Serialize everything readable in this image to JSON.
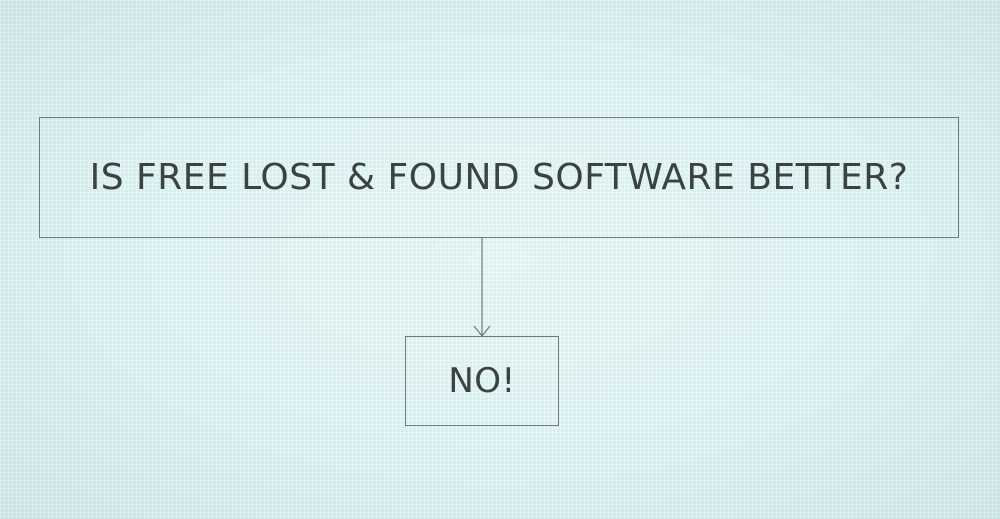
{
  "diagram": {
    "question": "IS FREE LOST & FOUND SOFTWARE BETTER?",
    "answer": "NO!",
    "colors": {
      "background": "#d6eeee",
      "border": "#6f7a7a",
      "text": "#3b4242"
    }
  }
}
